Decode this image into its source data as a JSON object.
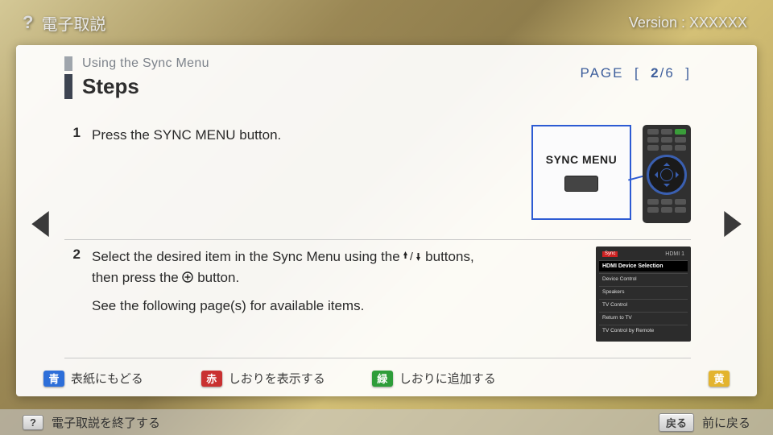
{
  "header": {
    "icon": "?",
    "title": "電子取説",
    "version": "Version : XXXXXX"
  },
  "page": {
    "breadcrumb": "Using the Sync Menu",
    "heading": "Steps",
    "indicator_prefix": "PAGE",
    "indicator_lb": "[",
    "indicator_cur": "2",
    "indicator_sep": "/",
    "indicator_total": "6",
    "indicator_rb": "]"
  },
  "steps": {
    "s1": {
      "num": "1",
      "text": "Press the SYNC MENU button."
    },
    "s2": {
      "num": "2",
      "text_a": "Select the desired item in the Sync Menu using the ",
      "text_b": " buttons, then press the ",
      "text_c": " button.",
      "sub": "See the following page(s) for available items."
    }
  },
  "graphic": {
    "sync_label": "SYNC MENU",
    "menu": {
      "brand": "Sync",
      "source": "HDMI 1",
      "sel": "HDMI Device Selection",
      "i1": "Device Control",
      "i2": "Speakers",
      "i3": "TV Control",
      "i4": "Return to TV",
      "i5": "TV Control by Remote"
    }
  },
  "colorbar": {
    "blue": {
      "char": "青",
      "label": "表紙にもどる"
    },
    "red": {
      "char": "赤",
      "label": "しおりを表示する"
    },
    "green": {
      "char": "緑",
      "label": "しおりに追加する"
    },
    "yellow": {
      "char": "黄"
    }
  },
  "footer": {
    "help_char": "?",
    "help_label": "電子取説を終了する",
    "back_btn": "戻る",
    "back_label": "前に戻る"
  }
}
